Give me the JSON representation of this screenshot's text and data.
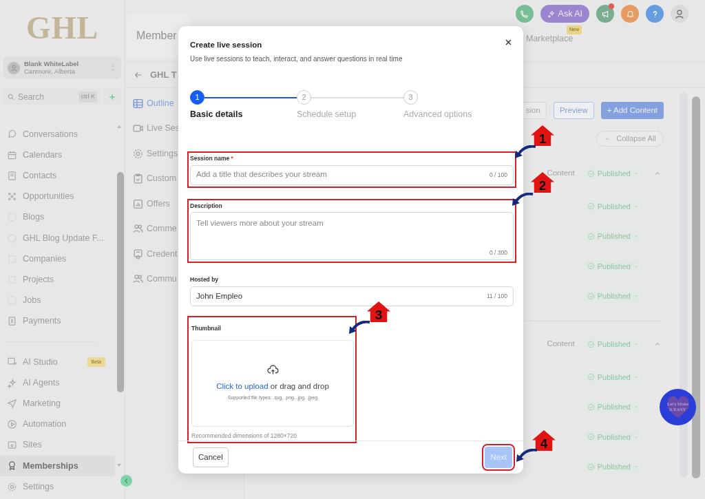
{
  "sidebar": {
    "logo": "GHL",
    "account": {
      "name": "Blank WhiteLabel",
      "location": "Canmore, Alberta"
    },
    "search": {
      "placeholder": "Search",
      "shortcut": "ctrl K"
    },
    "sections": [
      {
        "items": [
          {
            "label": "Conversations",
            "selected": false
          },
          {
            "label": "Calendars",
            "selected": false
          },
          {
            "label": "Contacts",
            "selected": false
          },
          {
            "label": "Opportunities",
            "selected": false
          },
          {
            "label": "Blogs",
            "selected": false
          },
          {
            "label": "GHL Blog Update F...",
            "selected": false
          },
          {
            "label": "Companies",
            "selected": false
          },
          {
            "label": "Projects",
            "selected": false
          },
          {
            "label": "Jobs",
            "selected": false
          },
          {
            "label": "Payments",
            "selected": false
          }
        ]
      },
      {
        "items": [
          {
            "label": "AI Studio",
            "selected": false,
            "badge": "Beta"
          },
          {
            "label": "AI Agents",
            "selected": false
          },
          {
            "label": "Marketing",
            "selected": false
          },
          {
            "label": "Automation",
            "selected": false
          },
          {
            "label": "Sites",
            "selected": false
          },
          {
            "label": "Memberships",
            "selected": true
          },
          {
            "label": "Settings",
            "selected": false
          }
        ]
      }
    ]
  },
  "header": {
    "title": "Member",
    "ask_ai": "Ask AI",
    "new_badge": "New",
    "marketplace": "Marketplace"
  },
  "course": {
    "title": "GHL T",
    "tabs": [
      {
        "label": "Outline",
        "selected": true
      },
      {
        "label": "Live Ses",
        "selected": false
      },
      {
        "label": "Settings",
        "selected": false
      },
      {
        "label": "Custom",
        "selected": false
      },
      {
        "label": "Offers",
        "selected": false
      },
      {
        "label": "Comme",
        "selected": false
      },
      {
        "label": "Credent",
        "selected": false
      },
      {
        "label": "Commu",
        "selected": false
      }
    ]
  },
  "toolbar": {
    "buttons": [
      {
        "label": "sion",
        "kind": "outline"
      },
      {
        "label": "Preview",
        "kind": "primary-outline"
      },
      {
        "label": "+ Add Content",
        "kind": "primary"
      }
    ],
    "collapse_all": "Collapse All"
  },
  "sections": [
    {
      "label": "Content",
      "status": "Published",
      "expanded": true,
      "lessons": [
        {
          "status": "Published"
        },
        {
          "status": "Published"
        },
        {
          "status": "Published"
        },
        {
          "status": "Published"
        }
      ]
    },
    {
      "label": "Content",
      "status": "Published",
      "expanded": true,
      "lessons": [
        {
          "status": "Published"
        },
        {
          "status": "Published"
        },
        {
          "status": "Published"
        },
        {
          "status": "Published"
        }
      ]
    }
  ],
  "floating_badge": {
    "text": "Let's Make It EASY"
  },
  "modal": {
    "title": "Create live session",
    "subtitle": "Use live sessions to teach, interact, and answer questions in real time",
    "steps": [
      {
        "number": "1",
        "label": "Basic details",
        "selected": true
      },
      {
        "number": "2",
        "label": "Schedule setup",
        "selected": false
      },
      {
        "number": "3",
        "label": "Advanced options",
        "selected": false
      }
    ],
    "fields": [
      {
        "kind": "input",
        "label": "Session name",
        "required_mark": "*",
        "placeholder": "Add a title that describes your stream",
        "counter": "0 / 100",
        "highlighted": true
      },
      {
        "kind": "textarea",
        "label": "Description",
        "placeholder": "Tell viewers more about your stream",
        "counter": "0 / 300",
        "highlighted": true
      },
      {
        "kind": "input",
        "label": "Hosted by",
        "value": "John Empleo",
        "counter": "11 / 100"
      }
    ],
    "thumbnail": {
      "label": "Thumbnail",
      "link": "Click to upload",
      "text": " or drag and drop",
      "types": "Supported file types: .svg, .png, .jpg, .jpeg",
      "hint": "Recommended dimensions of 1280×720",
      "highlighted": true
    },
    "cancel": "Cancel",
    "next": {
      "label": "Next",
      "disabled": true,
      "highlighted": true
    }
  },
  "annotations": [
    {
      "label": "1"
    },
    {
      "label": "2"
    },
    {
      "label": "3"
    },
    {
      "label": "4"
    }
  ]
}
